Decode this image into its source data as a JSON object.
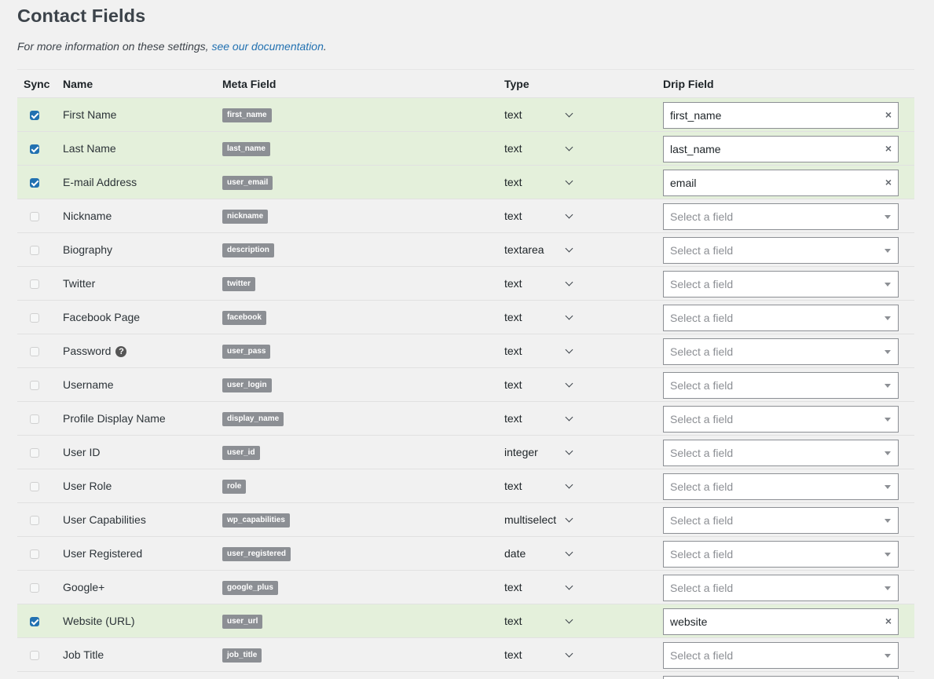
{
  "page": {
    "title": "Contact Fields",
    "description_prefix": "For more information on these settings, ",
    "doc_link": "see our documentation",
    "description_suffix": "."
  },
  "columns": {
    "sync": "Sync",
    "name": "Name",
    "meta": "Meta Field",
    "type": "Type",
    "drip": "Drip Field"
  },
  "colors": {
    "synced_row": "#e4f0db",
    "link": "#2271b1",
    "meta_badge": "#8c8f94",
    "checkbox_checked": "#2271b1"
  },
  "drip_placeholder": "Select a field",
  "rows": [
    {
      "checked": true,
      "name": "First Name",
      "meta": "first_name",
      "type": "text",
      "drip": "first_name"
    },
    {
      "checked": true,
      "name": "Last Name",
      "meta": "last_name",
      "type": "text",
      "drip": "last_name"
    },
    {
      "checked": true,
      "name": "E-mail Address",
      "meta": "user_email",
      "type": "text",
      "drip": "email"
    },
    {
      "checked": false,
      "name": "Nickname",
      "meta": "nickname",
      "type": "text",
      "drip": ""
    },
    {
      "checked": false,
      "name": "Biography",
      "meta": "description",
      "type": "textarea",
      "drip": ""
    },
    {
      "checked": false,
      "name": "Twitter",
      "meta": "twitter",
      "type": "text",
      "drip": ""
    },
    {
      "checked": false,
      "name": "Facebook Page",
      "meta": "facebook",
      "type": "text",
      "drip": ""
    },
    {
      "checked": false,
      "name": "Password",
      "meta": "user_pass",
      "type": "text",
      "drip": "",
      "help": true
    },
    {
      "checked": false,
      "name": "Username",
      "meta": "user_login",
      "type": "text",
      "drip": ""
    },
    {
      "checked": false,
      "name": "Profile Display Name",
      "meta": "display_name",
      "type": "text",
      "drip": ""
    },
    {
      "checked": false,
      "name": "User ID",
      "meta": "user_id",
      "type": "integer",
      "drip": ""
    },
    {
      "checked": false,
      "name": "User Role",
      "meta": "role",
      "type": "text",
      "drip": ""
    },
    {
      "checked": false,
      "name": "User Capabilities",
      "meta": "wp_capabilities",
      "type": "multiselect",
      "drip": ""
    },
    {
      "checked": false,
      "name": "User Registered",
      "meta": "user_registered",
      "type": "date",
      "drip": ""
    },
    {
      "checked": false,
      "name": "Google+",
      "meta": "google_plus",
      "type": "text",
      "drip": ""
    },
    {
      "checked": true,
      "name": "Website (URL)",
      "meta": "user_url",
      "type": "text",
      "drip": "website"
    },
    {
      "checked": false,
      "name": "Job Title",
      "meta": "job_title",
      "type": "text",
      "drip": ""
    }
  ]
}
